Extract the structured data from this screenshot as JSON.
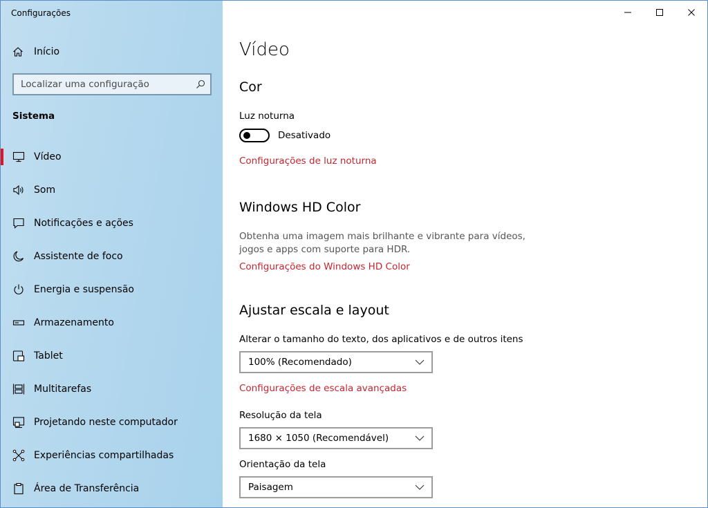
{
  "window": {
    "title": "Configurações",
    "controls": [
      "minimize",
      "maximize",
      "close"
    ]
  },
  "sidebar": {
    "home_label": "Início",
    "search_placeholder": "Localizar uma configuração",
    "section_label": "Sistema",
    "items": [
      {
        "label": "Vídeo",
        "icon": "monitor-icon",
        "active": true
      },
      {
        "label": "Som",
        "icon": "speaker-icon"
      },
      {
        "label": "Notificações e ações",
        "icon": "notification-icon"
      },
      {
        "label": "Assistente de foco",
        "icon": "moon-icon"
      },
      {
        "label": "Energia e suspensão",
        "icon": "power-icon"
      },
      {
        "label": "Armazenamento",
        "icon": "storage-icon"
      },
      {
        "label": "Tablet",
        "icon": "tablet-icon"
      },
      {
        "label": "Multitarefas",
        "icon": "multitask-icon"
      },
      {
        "label": "Projetando neste computador",
        "icon": "project-icon"
      },
      {
        "label": "Experiências compartilhadas",
        "icon": "share-icon"
      },
      {
        "label": "Área de Transferência",
        "icon": "clipboard-icon"
      }
    ]
  },
  "main": {
    "title": "Vídeo",
    "color_section": {
      "heading": "Cor",
      "night_light_label": "Luz noturna",
      "night_light_state": "Desativado",
      "night_light_link": "Configurações de luz noturna"
    },
    "hd_color_section": {
      "heading": "Windows HD Color",
      "description": "Obtenha uma imagem mais brilhante e vibrante para vídeos, jogos e apps com suporte para HDR.",
      "link": "Configurações do Windows HD Color"
    },
    "scale_section": {
      "heading": "Ajustar escala e layout",
      "text_size_label": "Alterar o tamanho do texto, dos aplicativos e de outros itens",
      "text_size_value": "100% (Recomendado)",
      "advanced_link": "Configurações de escala avançadas",
      "resolution_label": "Resolução da tela",
      "resolution_value": "1680 × 1050 (Recomendável)",
      "orientation_label": "Orientação da tela",
      "orientation_value": "Paisagem"
    }
  },
  "colors": {
    "accent": "#e81123",
    "link": "#c4262e"
  }
}
